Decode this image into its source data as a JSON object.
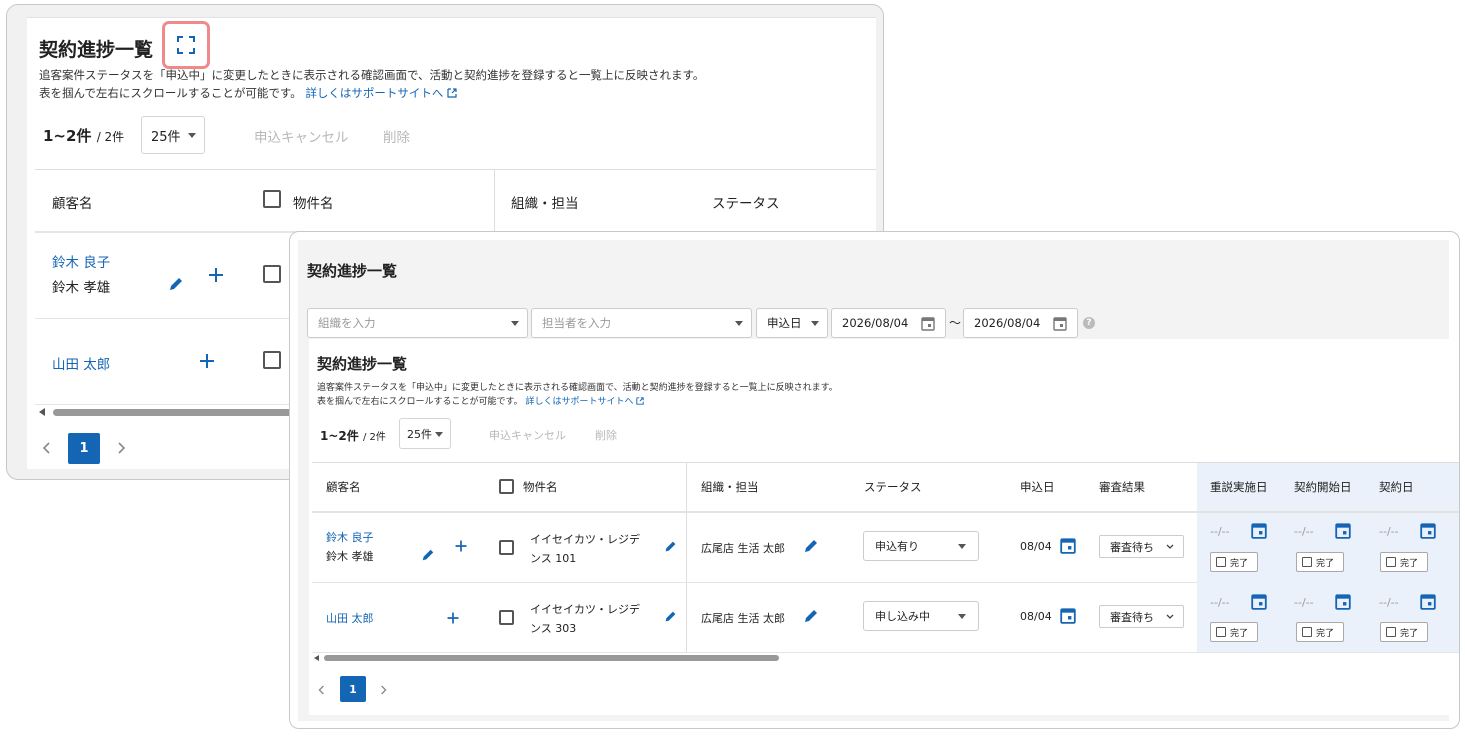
{
  "back": {
    "title": "契約進捗一覧",
    "desc1": "追客案件ステータスを「申込中」に変更したときに表示される確認画面で、活動と契約進捗を登録すると一覧上に反映されます。",
    "desc2": "表を掴んで左右にスクロールすることが可能です。",
    "support_link": "詳しくはサポートサイトへ",
    "count": "1~2件",
    "total": "/ 2件",
    "per_page": "25件",
    "cancel_label": "申込キャンセル",
    "delete_label": "削除",
    "headers": {
      "customer": "顧客名",
      "property": "物件名",
      "org": "組織・担当",
      "status": "ステータス"
    },
    "rows": [
      {
        "customer": "鈴木 良子",
        "customer2": "鈴木 孝雄"
      },
      {
        "customer": "山田 太郎"
      }
    ],
    "page": "1"
  },
  "front": {
    "title": "契約進捗一覧",
    "filters": {
      "org_placeholder": "組織を入力",
      "staff_placeholder": "担当者を入力",
      "date_type": "申込日",
      "date_from": "2026/08/04",
      "range_sep": "〜",
      "date_to": "2026/08/04"
    },
    "card_title": "契約進捗一覧",
    "desc1": "追客案件ステータスを「申込中」に変更したときに表示される確認画面で、活動と契約進捗を登録すると一覧上に反映されます。",
    "desc2": "表を掴んで左右にスクロールすることが可能です。",
    "support_link": "詳しくはサポートサイトへ",
    "count": "1~2件",
    "total": "/ 2件",
    "per_page": "25件",
    "cancel_label": "申込キャンセル",
    "delete_label": "削除",
    "headers": {
      "customer": "顧客名",
      "property": "物件名",
      "org": "組織・担当",
      "status": "ステータス",
      "apply_date": "申込日",
      "review": "審査結果",
      "explain_date": "重説実施日",
      "start_date": "契約開始日",
      "contract_date": "契約日"
    },
    "rows": [
      {
        "customer": "鈴木 良子",
        "customer2": "鈴木 孝雄",
        "property": "イイセイカツ・レジデンス 101",
        "org": "広尾店 生活 太郎",
        "status": "申込有り",
        "apply": "08/04",
        "review": "審査待ち",
        "date_empty": "--/--",
        "done": "完了"
      },
      {
        "customer": "山田 太郎",
        "property": "イイセイカツ・レジデンス 303",
        "org": "広尾店 生活 太郎",
        "status": "申し込み中",
        "apply": "08/04",
        "review": "審査待ち",
        "date_empty": "--/--",
        "done": "完了"
      }
    ],
    "page": "1"
  },
  "colors": {
    "link": "#1565b5",
    "highlight": "#f08a8a",
    "page_active": "#1565b5",
    "shade": "#eaf1fa"
  }
}
